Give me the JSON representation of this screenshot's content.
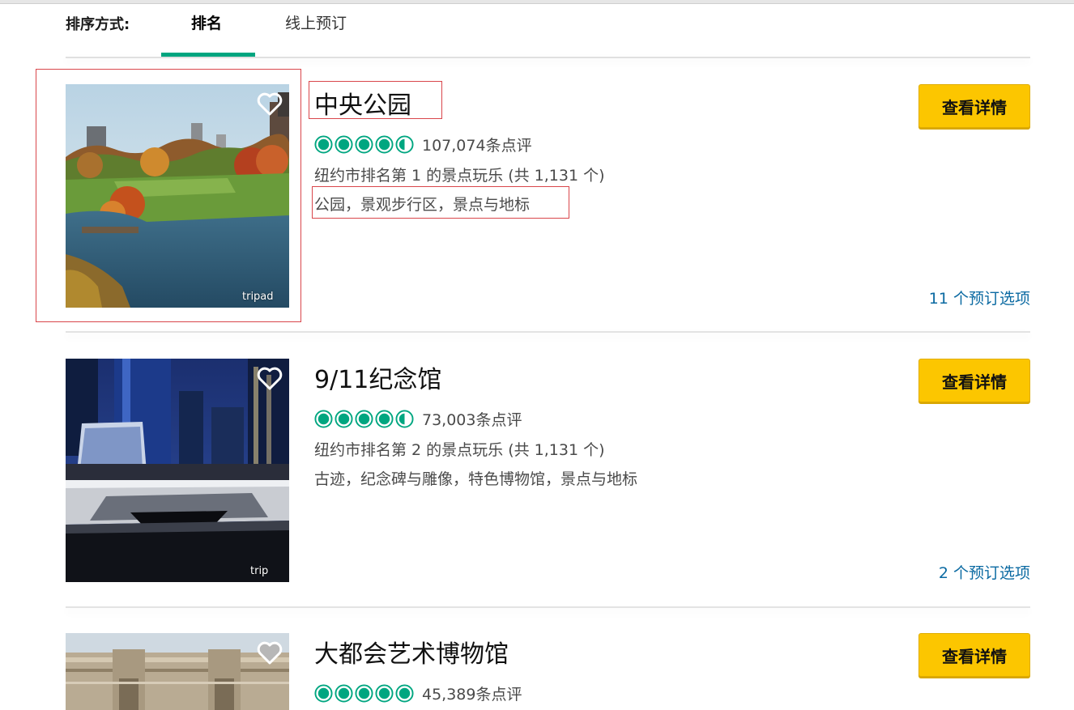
{
  "sort": {
    "label": "排序方式:",
    "tabs": [
      {
        "label": "排名",
        "active": true
      },
      {
        "label": "线上预订",
        "active": false
      }
    ]
  },
  "accent_color": "#00a680",
  "button_color": "#fcc600",
  "link_color": "#0b6aa2",
  "attractions": [
    {
      "name": "中央公园",
      "rating": 4.5,
      "reviews": "107,074条点评",
      "rank": "纽约市排名第 1 的景点玩乐 (共 1,131 个)",
      "categories": "公园，景观步行区，景点与地标",
      "button": "查看详情",
      "options": "11 个预订选项",
      "watermark": "tripad"
    },
    {
      "name": "9/11纪念馆",
      "rating": 4.5,
      "reviews": "73,003条点评",
      "rank": "纽约市排名第 2 的景点玩乐 (共 1,131 个)",
      "categories": "古迹，纪念碑与雕像，特色博物馆，景点与地标",
      "button": "查看详情",
      "options": "2 个预订选项",
      "watermark": "trip"
    },
    {
      "name": "大都会艺术博物馆",
      "rating": 5,
      "reviews": "45,389条点评",
      "button": "查看详情"
    }
  ]
}
